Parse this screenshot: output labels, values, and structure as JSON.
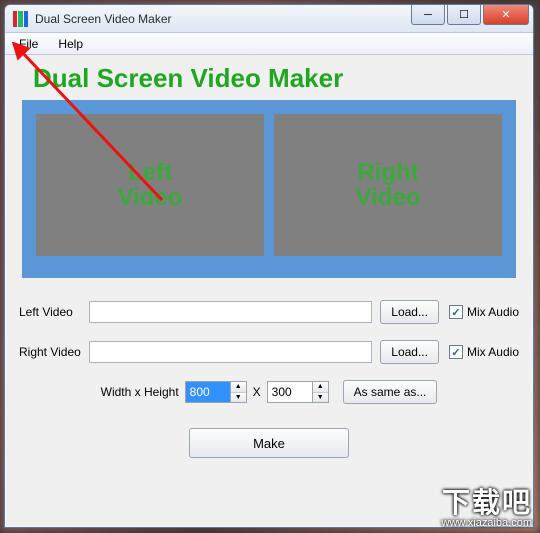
{
  "window": {
    "title": "Dual Screen Video Maker",
    "icon_colors": [
      "#d23",
      "#2b6",
      "#26d"
    ]
  },
  "menu": {
    "file": "File",
    "help": "Help"
  },
  "heading": "Dual Screen Video Maker",
  "preview": {
    "left": "Left\nVideo",
    "right": "Right\nVideo"
  },
  "form": {
    "left_label": "Left Video",
    "left_value": "",
    "left_load": "Load...",
    "left_mix_label": "Mix Audio",
    "left_mix_checked": true,
    "right_label": "Right Video",
    "right_value": "",
    "right_load": "Load...",
    "right_mix_label": "Mix Audio",
    "right_mix_checked": true
  },
  "dims": {
    "label": "Width x Height",
    "x": "X",
    "width": "800",
    "height": "300",
    "same": "As same as..."
  },
  "make": "Make",
  "watermark": {
    "text": "下载吧",
    "url": "www.xiazaiba.com"
  }
}
